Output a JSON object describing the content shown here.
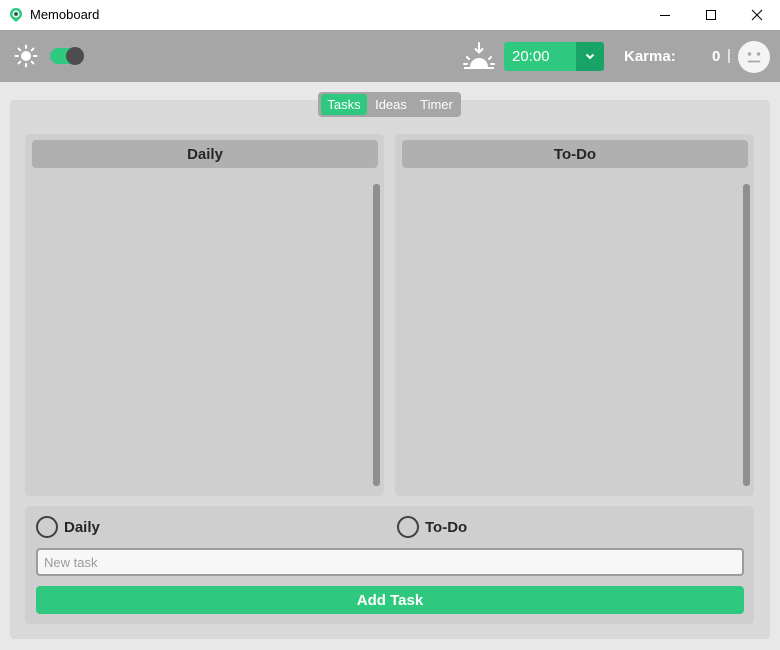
{
  "window": {
    "title": "Memoboard",
    "app_icon": "memoboard-logo-icon",
    "controls": [
      "minimize-icon",
      "maximize-icon",
      "close-icon"
    ]
  },
  "toolbar": {
    "theme_icon": "sun-icon",
    "dark_mode_on": true,
    "schedule_icon": "sunset-icon",
    "time_value": "20:00",
    "karma_label": "Karma:",
    "karma_value": "0",
    "separator": "|",
    "mood_icon": "neutral-face-icon"
  },
  "tabs": [
    {
      "label": "Tasks",
      "active": true
    },
    {
      "label": "Ideas",
      "active": false
    },
    {
      "label": "Timer",
      "active": false
    }
  ],
  "columns": [
    {
      "title": "Daily",
      "items": []
    },
    {
      "title": "To-Do",
      "items": []
    }
  ],
  "add_task": {
    "options": [
      {
        "label": "Daily",
        "selected": false
      },
      {
        "label": "To-Do",
        "selected": false
      }
    ],
    "input_value": "",
    "input_placeholder": "New task",
    "button_label": "Add Task"
  },
  "colors": {
    "accent": "#2ec97f",
    "accent_dark": "#17a466",
    "toolbar_bg": "#a6a6a6",
    "panel_bg": "#d9d9d9",
    "column_bg": "#cfcfcf"
  }
}
